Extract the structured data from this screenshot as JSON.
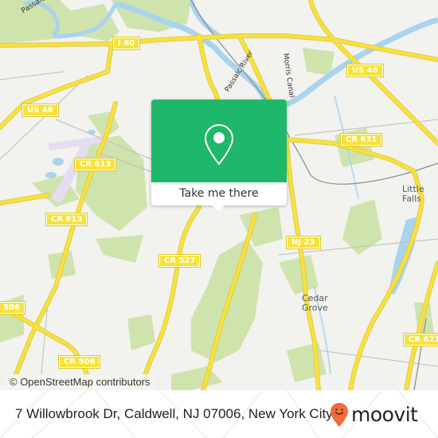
{
  "map": {
    "colors": {
      "background": "#f2f2ee",
      "park": "#cfe3ad",
      "water": "#a9d3ee",
      "road": "#f6e23a",
      "road_casing": "#e4c94a",
      "rail": "#8a8a8a",
      "airport": "#e6dcf2"
    },
    "shields": [
      {
        "id": "i80",
        "label": "I 80"
      },
      {
        "id": "us46-east",
        "label": "US 46"
      },
      {
        "id": "us46-west",
        "label": "US 46"
      },
      {
        "id": "cr631",
        "label": "CR 631"
      },
      {
        "id": "cr613-north",
        "label": "CR 613"
      },
      {
        "id": "cr613-south",
        "label": "CR 613"
      },
      {
        "id": "nj23",
        "label": "NJ 23"
      },
      {
        "id": "cr527",
        "label": "CR 527"
      },
      {
        "id": "cr506-west",
        "label": "506"
      },
      {
        "id": "cr506-south",
        "label": "CR 506"
      },
      {
        "id": "cr621",
        "label": "CR 621"
      }
    ],
    "places": [
      {
        "id": "little-falls",
        "label": "Little\nFalls"
      },
      {
        "id": "cedar-grove",
        "label": "Cedar\nGrove"
      }
    ],
    "water_labels": [
      {
        "id": "passaic-river-nw",
        "label": "Passaic River"
      },
      {
        "id": "passaic-river-center",
        "label": "Passaic River"
      },
      {
        "id": "morris-canal",
        "label": "Morris Canal"
      }
    ],
    "attribution": "© OpenStreetMap contributors"
  },
  "popup": {
    "icon": "map-pin-icon",
    "cta_label": "Take me there",
    "accent": "#1fb86a"
  },
  "footer": {
    "address": "7 Willowbrook Dr, Caldwell, NJ 07006, New York City",
    "brand": {
      "name": "moovit",
      "icon": "moovit-smiley-pin-icon",
      "accent": "#f26b3a"
    }
  }
}
